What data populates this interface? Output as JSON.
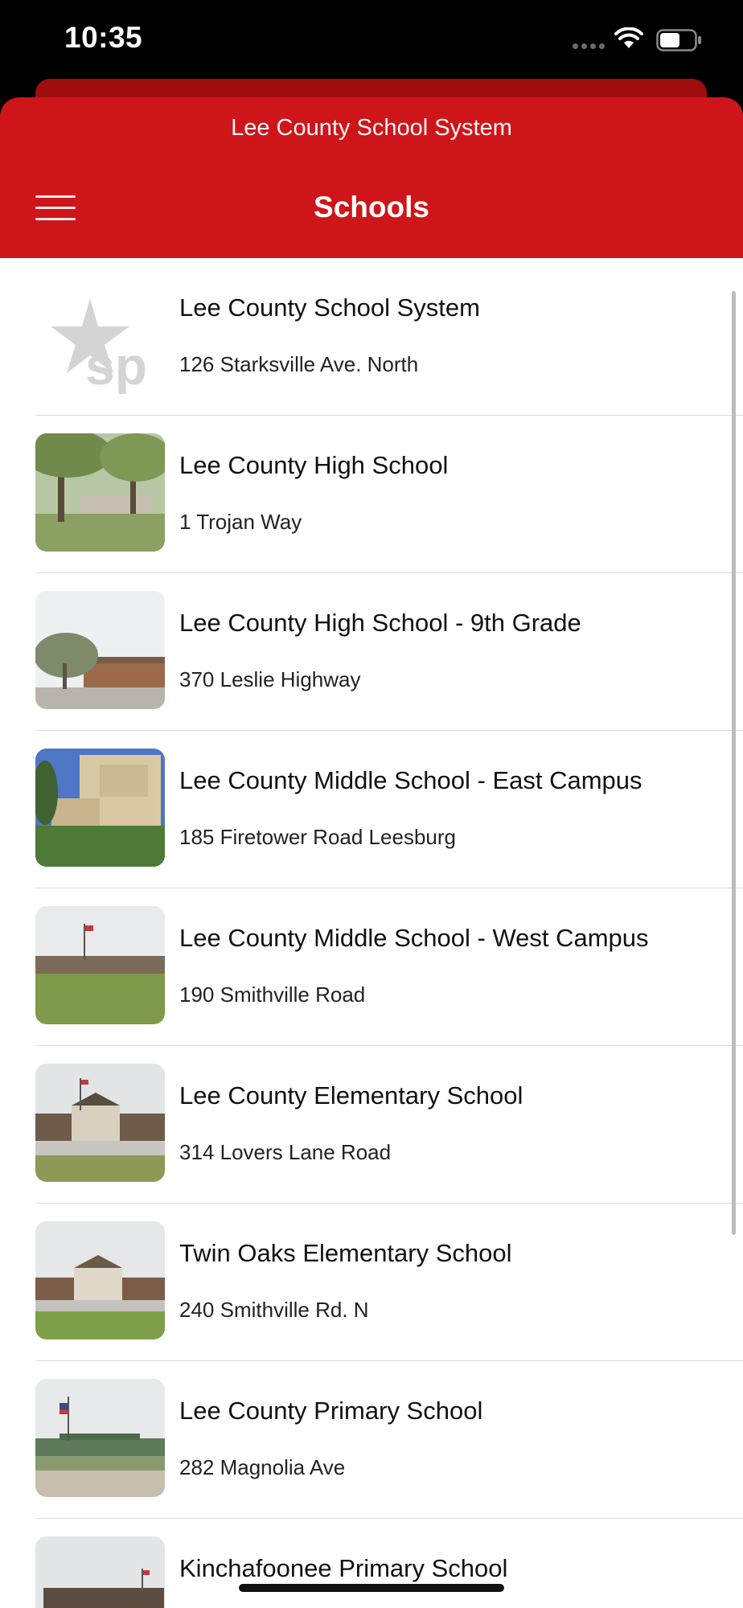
{
  "status_bar": {
    "time": "10:35"
  },
  "header": {
    "subtitle": "Lee County School System",
    "title": "Schools",
    "accent_color": "#ce1519"
  },
  "schools": [
    {
      "name": "Lee County School System",
      "address": "126 Starksville Ave. North",
      "thumb": "district-logo"
    },
    {
      "name": "Lee County High School",
      "address": "1 Trojan Way",
      "thumb": "trees-sign-photo"
    },
    {
      "name": "Lee County High School - 9th Grade",
      "address": "370 Leslie Highway",
      "thumb": "oak-brick-photo"
    },
    {
      "name": "Lee County Middle School - East Campus",
      "address": "185 Firetower Road Leesburg",
      "thumb": "tan-building-photo"
    },
    {
      "name": "Lee County Middle School - West Campus",
      "address": "190 Smithville Road",
      "thumb": "field-building-photo"
    },
    {
      "name": "Lee County Elementary School",
      "address": "314 Lovers Lane Road",
      "thumb": "portico-building-photo"
    },
    {
      "name": "Twin Oaks Elementary School",
      "address": "240 Smithville Rd. N",
      "thumb": "portico-building-photo"
    },
    {
      "name": "Lee County Primary School",
      "address": "282 Magnolia Ave",
      "thumb": "green-roof-photo"
    },
    {
      "name": "Kinchafoonee Primary School",
      "address": "",
      "thumb": "building-photo"
    }
  ]
}
